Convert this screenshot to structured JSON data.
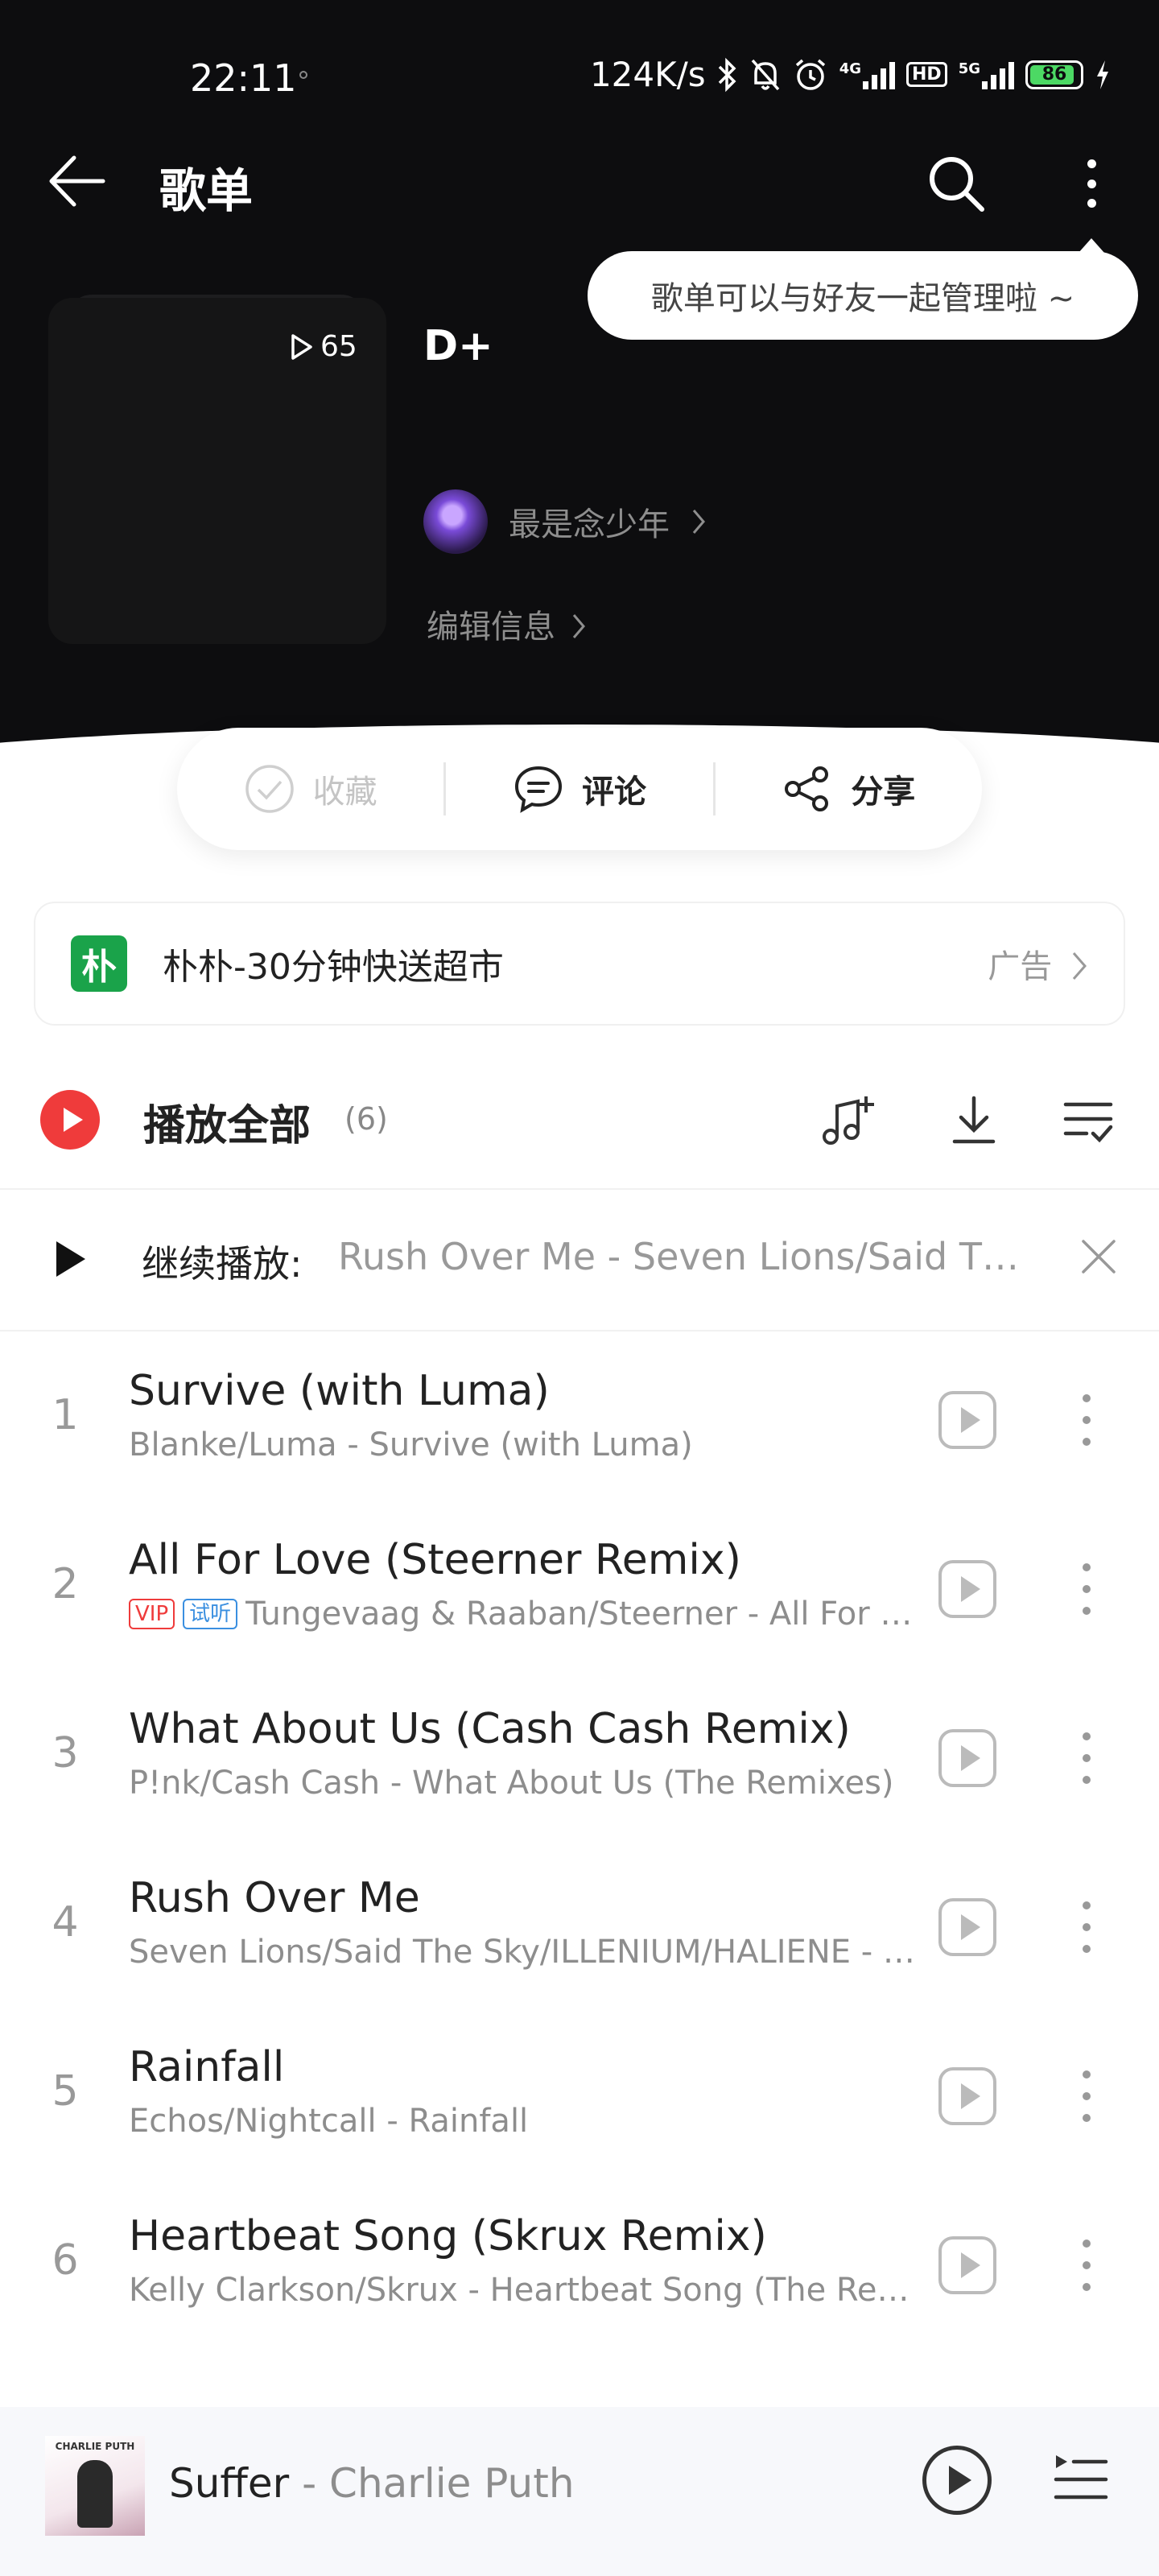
{
  "status": {
    "time": "22:11",
    "net_speed": "124K/s",
    "net_4g": "4G",
    "hd": "HD",
    "net_5g": "5G",
    "battery": "86"
  },
  "header": {
    "title": "歌单",
    "tooltip": "歌单可以与好友一起管理啦 ~"
  },
  "playlist": {
    "play_count": "65",
    "name": "D+",
    "creator": "最是念少年",
    "edit_label": "编辑信息"
  },
  "actions": {
    "collect": "收藏",
    "comment": "评论",
    "share": "分享"
  },
  "ad": {
    "logo_text": "朴",
    "text": "朴朴-30分钟快送超市",
    "tag": "广告"
  },
  "play_all": {
    "label": "播放全部",
    "count": "(6)"
  },
  "resume": {
    "label": "继续播放:",
    "song": "Rush Over Me - Seven Lions/Said The Sky/ILLENIUM/HALIENE"
  },
  "songs": [
    {
      "num": "1",
      "title": "Survive (with Luma)",
      "subtitle": "Blanke/Luma - Survive (with Luma)"
    },
    {
      "num": "2",
      "title": "All For Love (Steerner Remix)",
      "subtitle": "Tungevaag & Raaban/Steerner - All For Love (Steerner Remix)",
      "tags": [
        "VIP",
        "试听"
      ]
    },
    {
      "num": "3",
      "title": "What About Us (Cash Cash Remix)",
      "subtitle": "P!nk/Cash Cash - What About Us (The Remixes)"
    },
    {
      "num": "4",
      "title": "Rush Over Me",
      "subtitle": "Seven Lions/Said The Sky/ILLENIUM/HALIENE - Rush Over Me"
    },
    {
      "num": "5",
      "title": "Rainfall",
      "subtitle": "Echos/Nightcall - Rainfall"
    },
    {
      "num": "6",
      "title": "Heartbeat Song (Skrux Remix)",
      "subtitle": "Kelly Clarkson/Skrux - Heartbeat Song (The Remixes)"
    }
  ],
  "mini_player": {
    "cover_caption": "CHARLIE PUTH",
    "title": "Suffer",
    "separator": " - ",
    "artist": "Charlie Puth"
  }
}
